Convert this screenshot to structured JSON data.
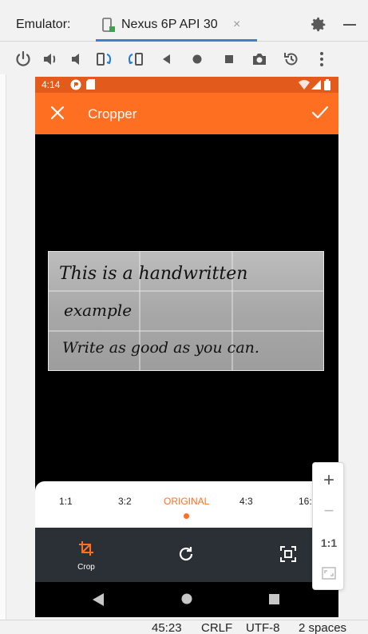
{
  "emulator": {
    "label": "Emulator:",
    "device_tab": "Nexus 6P API 30",
    "close_glyph": "×"
  },
  "phone": {
    "status_time": "4:14",
    "app_title": "Cropper",
    "handwriting": [
      "This is a handwritten",
      "example",
      "Write as good as you can."
    ],
    "ratios": [
      "1:1",
      "3:2",
      "ORIGINAL",
      "4:3",
      "16:"
    ],
    "active_ratio": "ORIGINAL",
    "crop_label": "Crop"
  },
  "zoom": {
    "plus": "+",
    "minus": "−",
    "one_to_one": "1:1"
  },
  "ide_status": {
    "position": "45:23",
    "line_ending": "CRLF",
    "encoding": "UTF-8",
    "indent": "2 spaces"
  },
  "colors": {
    "accent": "#ff6f22",
    "status": "#e25a1c",
    "tools_bg": "#2b2f36",
    "tab_underline": "#3d7fd1"
  },
  "icons": [
    "device-icon",
    "gear-icon",
    "power-icon",
    "volume-up-icon",
    "volume-down-icon",
    "rotate-left-icon",
    "rotate-right-icon",
    "back-icon",
    "home-icon",
    "overview-icon",
    "camera-icon",
    "snapshot-icon",
    "more-icon",
    "close-icon",
    "check-icon",
    "crop-icon",
    "rotate-icon",
    "scale-icon",
    "fit-screen-icon"
  ]
}
